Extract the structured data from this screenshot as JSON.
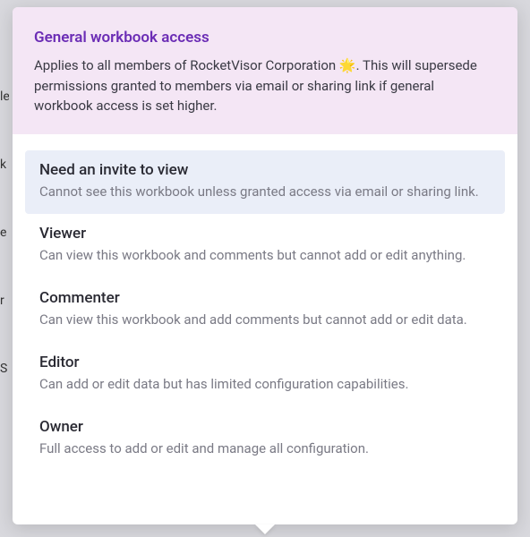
{
  "header": {
    "title": "General workbook access",
    "subtitle": "Applies to all members of RocketVisor Corporation 🌟. This will supersede permissions granted to members via email or sharing link if general workbook access is set higher."
  },
  "options": [
    {
      "title": "Need an invite to view",
      "desc": "Cannot see this workbook unless granted access via email or sharing link.",
      "selected": true
    },
    {
      "title": "Viewer",
      "desc": "Can view this workbook and comments but cannot add or edit anything.",
      "selected": false
    },
    {
      "title": "Commenter",
      "desc": "Can view this workbook and add comments but cannot add or edit data.",
      "selected": false
    },
    {
      "title": "Editor",
      "desc": "Can add or edit data but has limited configuration capabilities.",
      "selected": false
    },
    {
      "title": "Owner",
      "desc": "Full access to add or edit and manage all configuration.",
      "selected": false
    }
  ]
}
